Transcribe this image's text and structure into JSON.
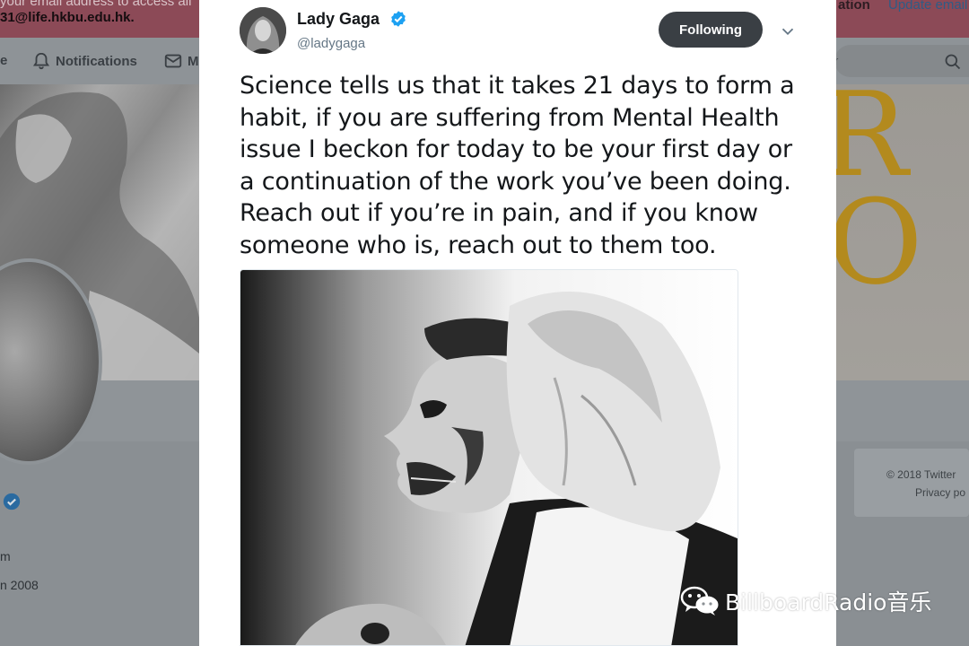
{
  "banner": {
    "line1": "your email address to access all",
    "line2": "31@life.hkbu.edu.hk.",
    "action_partial": "ation",
    "update_email": "Update email"
  },
  "nav": {
    "home_partial": "e",
    "notifications": "Notifications",
    "messages_partial": "M",
    "search_partial": "r"
  },
  "profile": {
    "text1": "m",
    "text2": "n 2008"
  },
  "footer": {
    "copyright": "© 2018 Twitter",
    "privacy": "Privacy po"
  },
  "tweet": {
    "author_name": "Lady Gaga",
    "author_handle": "@ladygaga",
    "follow_label": "Following",
    "text": "Science tells us that it takes 21 days to form a habit, if you are suffering from Mental Health issue I beckon for today to be your first day or a continuation of the work you’ve been doing. Reach out if you’re in pain, and if you know someone who is, reach out to them too."
  },
  "watermark": {
    "text": "BillboardRadio音乐"
  },
  "icons": {
    "verified": "verified-badge-icon",
    "bell": "bell-icon",
    "mail": "mail-icon",
    "search": "search-icon",
    "caret": "chevron-down-icon",
    "wechat": "wechat-icon"
  },
  "colors": {
    "verified_blue": "#1da1f2",
    "follow_button": "#3a3f44",
    "banner": "#8c4a57"
  }
}
